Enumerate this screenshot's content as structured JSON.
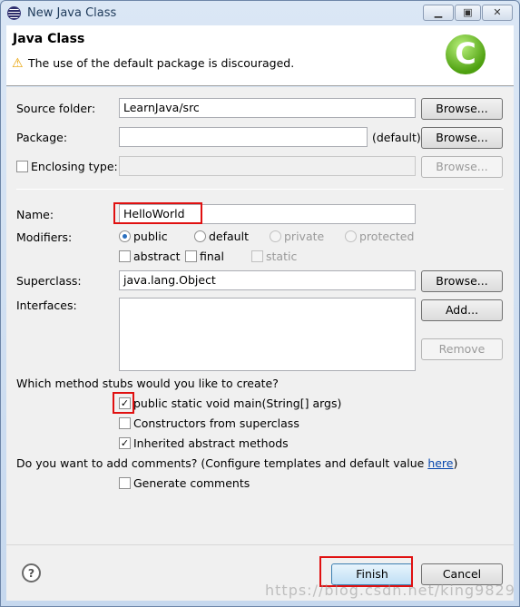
{
  "window": {
    "title": "New Java Class"
  },
  "header": {
    "title": "Java Class",
    "message": "The use of the default package is discouraged."
  },
  "form": {
    "source_folder": {
      "label": "Source folder:",
      "value": "LearnJava/src",
      "browse": "Browse..."
    },
    "package": {
      "label": "Package:",
      "value": "",
      "hint": "(default)",
      "browse": "Browse..."
    },
    "enclosing": {
      "label": "Enclosing type:",
      "value": "",
      "browse": "Browse...",
      "checked": false
    },
    "name": {
      "label": "Name:",
      "value": "HelloWorld"
    },
    "modifiers": {
      "label": "Modifiers:",
      "public": "public",
      "default": "default",
      "private": "private",
      "protected": "protected",
      "abstract": "abstract",
      "final": "final",
      "static": "static",
      "selected": "public"
    },
    "superclass": {
      "label": "Superclass:",
      "value": "java.lang.Object",
      "browse": "Browse..."
    },
    "interfaces": {
      "label": "Interfaces:",
      "add": "Add...",
      "remove": "Remove"
    },
    "stubs": {
      "question": "Which method stubs would you like to create?",
      "main": "public static void main(String[] args)",
      "constructors": "Constructors from superclass",
      "inherited": "Inherited abstract methods",
      "main_checked": true,
      "constructors_checked": false,
      "inherited_checked": true
    },
    "comments": {
      "question": "Do you want to add comments? (Configure templates and default value ",
      "link": "here",
      "close": ")",
      "generate": "Generate comments",
      "generate_checked": false
    }
  },
  "footer": {
    "finish": "Finish",
    "cancel": "Cancel"
  },
  "watermark": "https://blog.csdn.net/king9829"
}
